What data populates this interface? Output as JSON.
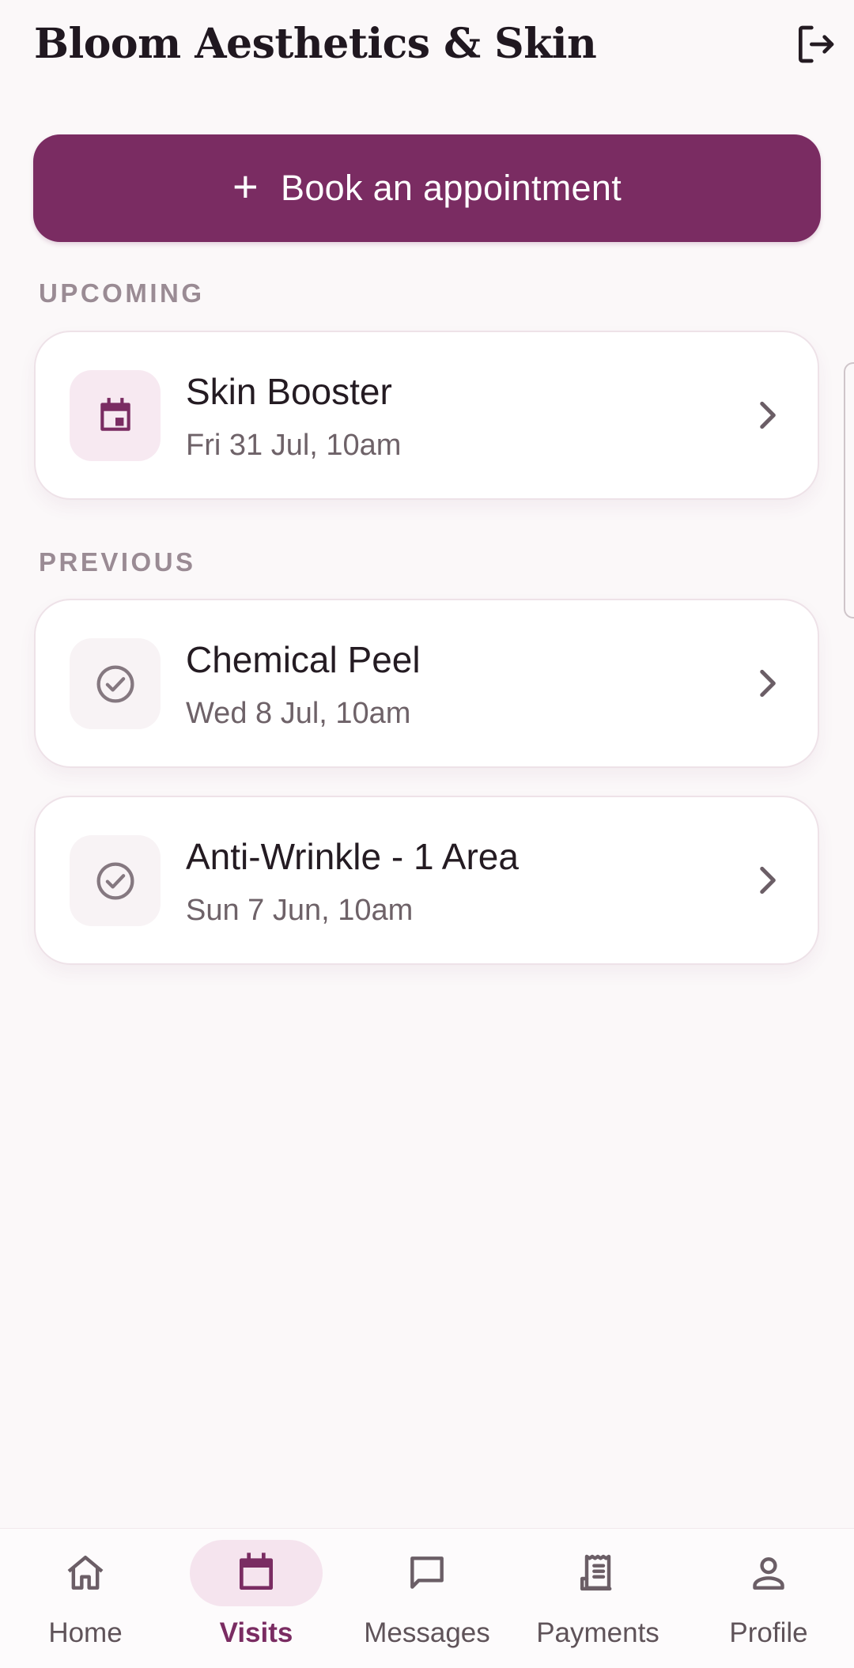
{
  "header": {
    "title": "Bloom Aesthetics & Skin",
    "logout_icon": "logout-icon"
  },
  "book_button": {
    "icon": "plus-icon",
    "plus": "+",
    "label": "Book an appointment"
  },
  "upcoming": {
    "heading": "UPCOMING",
    "items": [
      {
        "title": "Skin Booster",
        "datetime": "Fri 31 Jul, 10am",
        "icon": "calendar-icon"
      }
    ]
  },
  "previous": {
    "heading": "PREVIOUS",
    "items": [
      {
        "title": "Chemical Peel",
        "datetime": "Wed 8 Jul, 10am",
        "icon": "check-circle-icon"
      },
      {
        "title": "Anti-Wrinkle - 1 Area",
        "datetime": "Sun 7 Jun, 10am",
        "icon": "check-circle-icon"
      }
    ]
  },
  "nav": {
    "active": "Visits",
    "items": [
      {
        "label": "Home",
        "icon": "home-icon"
      },
      {
        "label": "Visits",
        "icon": "calendar-icon"
      },
      {
        "label": "Messages",
        "icon": "message-icon"
      },
      {
        "label": "Payments",
        "icon": "receipt-icon"
      },
      {
        "label": "Profile",
        "icon": "person-icon"
      }
    ]
  },
  "colors": {
    "brand": "#7a2c62",
    "background": "#fbf8f9",
    "active_pill": "#f5e4ee",
    "muted_text": "#9a8b94"
  }
}
